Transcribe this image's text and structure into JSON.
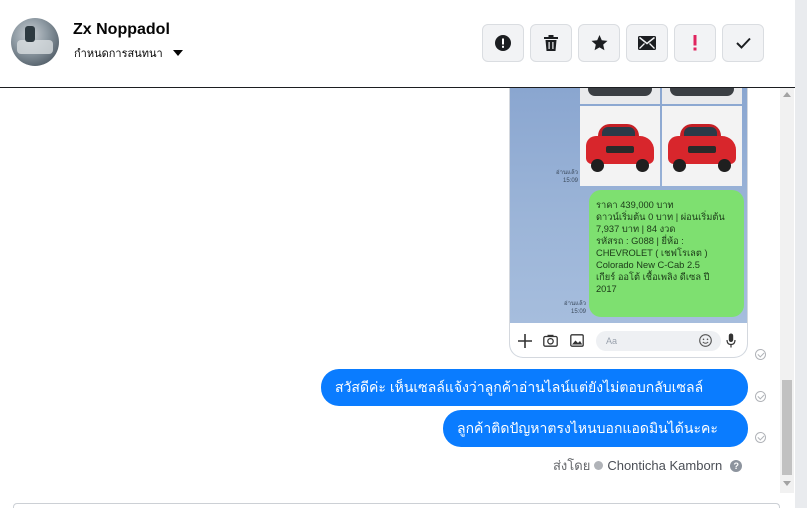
{
  "header": {
    "contact_name": "Zx Noppadol",
    "assign_label": "กำหนดการสนทนา",
    "actions": [
      {
        "name": "mark-spam-button",
        "icon": "alert-circle-icon"
      },
      {
        "name": "delete-button",
        "icon": "trash-icon"
      },
      {
        "name": "star-button",
        "icon": "star-icon"
      },
      {
        "name": "mark-unread-button",
        "icon": "envelope-icon"
      },
      {
        "name": "follow-up-button",
        "icon": "exclamation-icon",
        "color": "#e0245e"
      },
      {
        "name": "mark-done-button",
        "icon": "check-icon"
      }
    ]
  },
  "screenshot": {
    "time_label_1": "อ่านแล้ว\n15:09",
    "time_label_2": "อ่านแล้ว\n15:09",
    "green_message": "ราคา 439,000 บาท\nดาวน์เริ่มต้น 0 บาท | ผ่อนเริ่มต้น\n7,937 บาท | 84 งวด\n รหัสรถ : G088 |  ยี่ห้อ :\nCHEVROLET ( เชฟโรเลต )\nColorado New C-Cab 2.5\n เกียร์ ออโต้   เชื้อเพลิง ดีเซล   ปี\n2017",
    "input_placeholder": "Aa",
    "green_color": "#7ee070"
  },
  "messages": [
    {
      "text": "สวัสดีค่ะ เห็นเซลล์แจ้งว่าลูกค้าอ่านไลน์แต่ยังไม่ตอบกลับเซลล์"
    },
    {
      "text": "ลูกค้าติดปัญหาตรงไหนบอกแอดมินได้นะคะ"
    }
  ],
  "sent_by": {
    "prefix": "ส่งโดย",
    "agent": "Chonticha Kamborn",
    "help": "?"
  },
  "colors": {
    "bubble": "#0a7cff",
    "accent_red": "#e0245e"
  }
}
